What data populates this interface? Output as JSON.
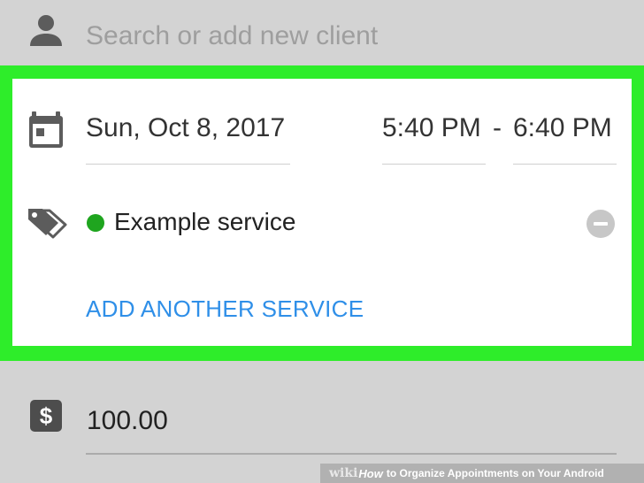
{
  "client": {
    "placeholder": "Search or add new client",
    "icon": "person-icon"
  },
  "schedule": {
    "icon": "calendar-icon",
    "date": "Sun, Oct 8, 2017",
    "start_time": "5:40 PM",
    "separator": "-",
    "end_time": "6:40 PM"
  },
  "services": {
    "icon": "tag-icon",
    "items": [
      {
        "name": "Example service",
        "color": "#1fa51f"
      }
    ],
    "add_label": "ADD ANOTHER SERVICE",
    "remove_icon": "remove-circle-icon"
  },
  "price": {
    "icon": "dollar-icon",
    "icon_glyph": "$",
    "value": "100.00"
  },
  "highlight_color": "#2eed2a",
  "link_color": "#2f8fe8",
  "watermark": {
    "brand_wiki": "wiki",
    "brand_how": "How",
    "caption": "to Organize Appointments on Your Android"
  }
}
